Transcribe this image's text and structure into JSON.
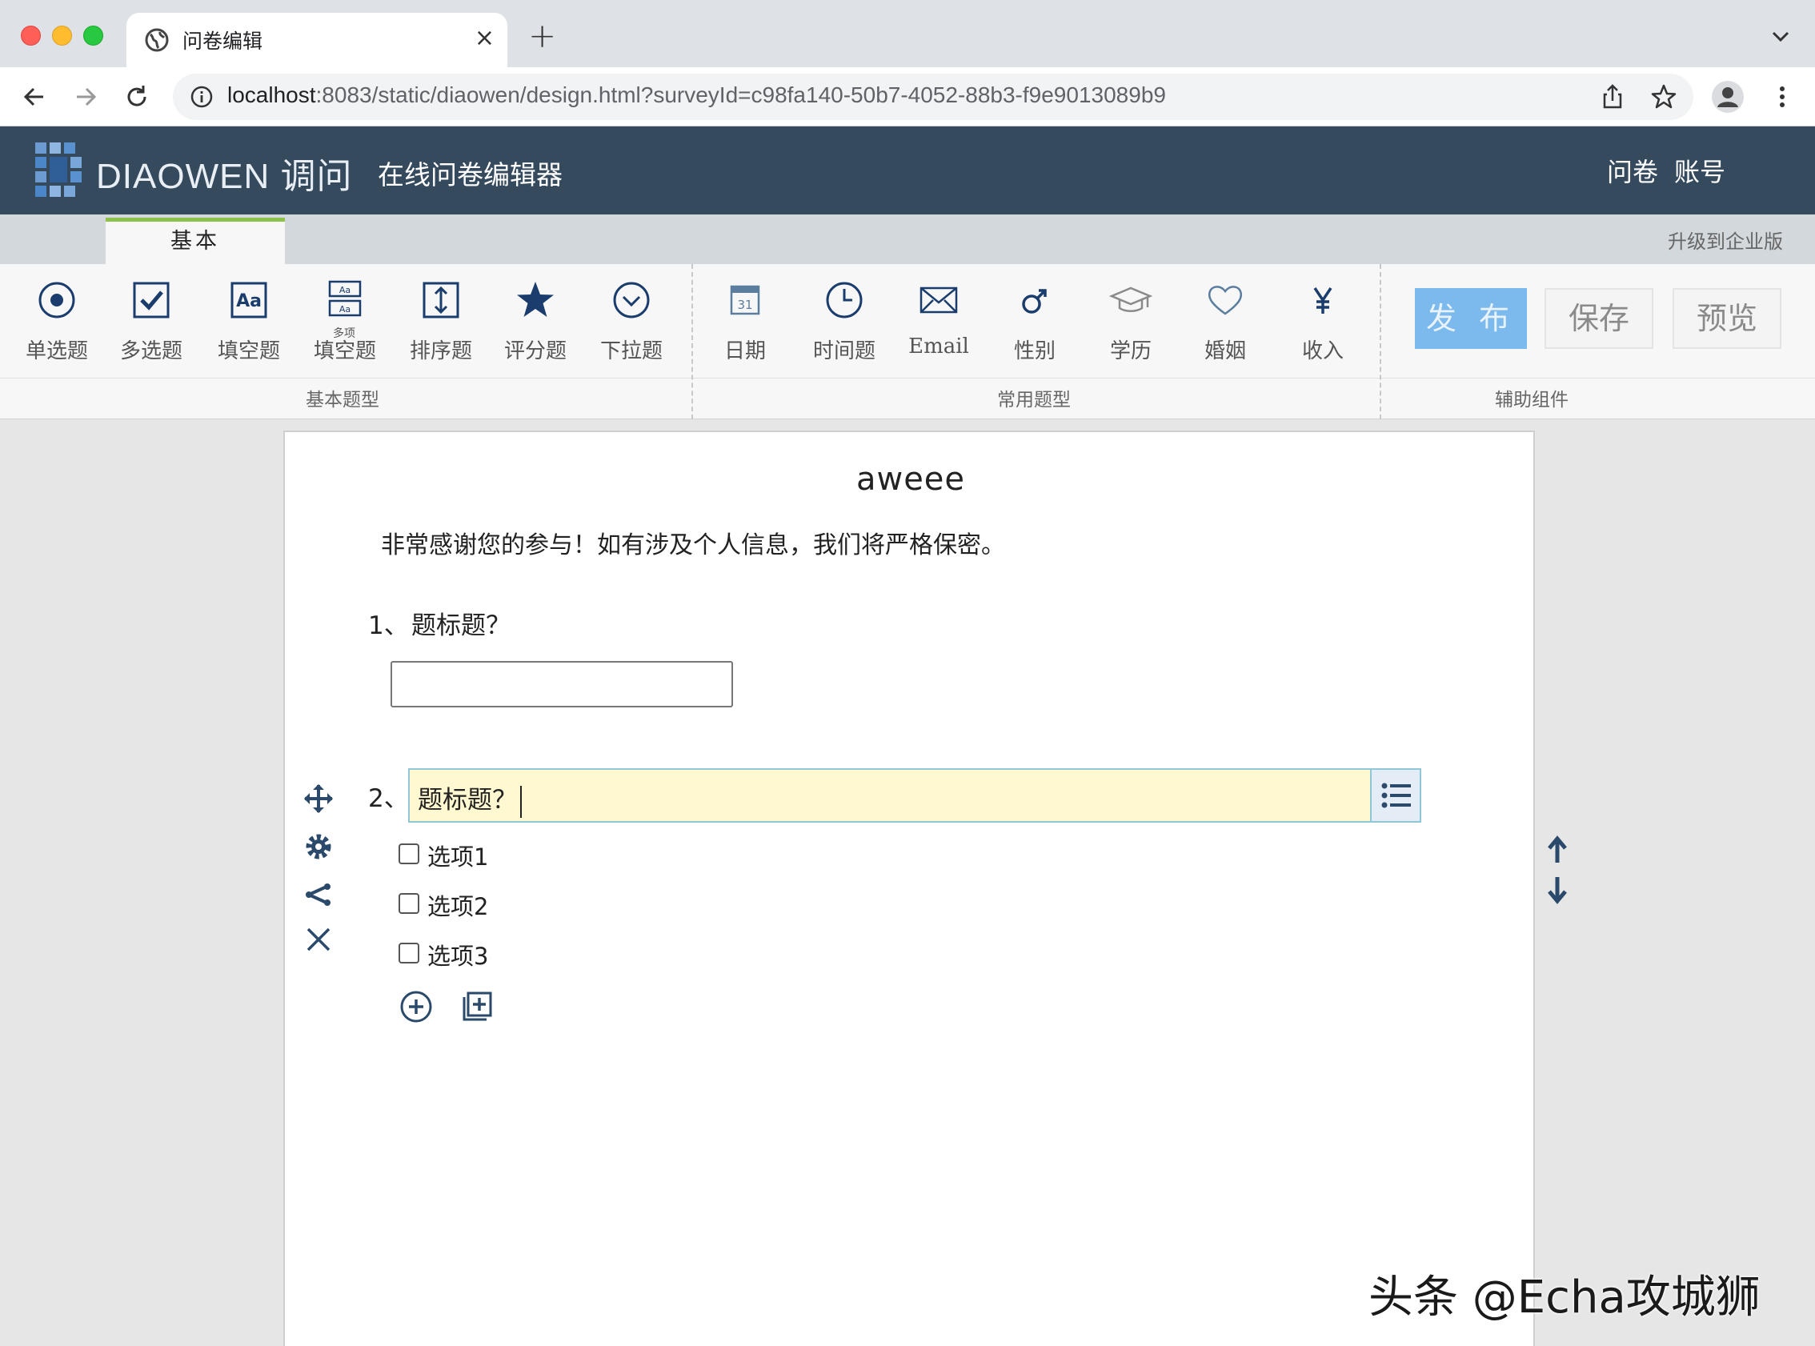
{
  "browser": {
    "tab_title": "问卷编辑",
    "tab_close": "×",
    "new_tab": "+",
    "url_host": "localhost",
    "url_path": ":8083/static/diaowen/design.html?surveyId=c98fa140-50b7-4052-88b3-f9e9013089b9"
  },
  "header": {
    "logo_text": "DIAOWEN 调问",
    "subtitle": "在线问卷编辑器",
    "links": [
      "问卷",
      "账号"
    ]
  },
  "ribbon": {
    "active_tab": "基本",
    "upgrade_link": "升级到企业版",
    "groups": {
      "basic": "基本题型",
      "common": "常用题型",
      "auxiliary": "辅助组件"
    },
    "basic_tools": [
      "单选题",
      "多选题",
      "填空题",
      "填空题",
      "排序题",
      "评分题",
      "下拉题"
    ],
    "multi_fill_badge": "多项",
    "common_tools": [
      "日期",
      "时间题",
      "Email",
      "性别",
      "学历",
      "婚姻",
      "收入"
    ],
    "actions": {
      "publish": "发 布",
      "save": "保存",
      "preview": "预览"
    }
  },
  "survey": {
    "title": "aweee",
    "description": "非常感谢您的参与！如有涉及个人信息，我们将严格保密。",
    "q1": {
      "number": "1、",
      "title": "题标题？"
    },
    "q2": {
      "number": "2、",
      "title": "题标题？",
      "options": [
        "选项1",
        "选项2",
        "选项3"
      ]
    }
  },
  "watermark": "头条 @Echa攻城狮",
  "colors": {
    "header_bg": "#364a5e",
    "ribbon_accent": "#8bc34a",
    "publish_btn": "#7cb9ec",
    "editing_bg": "#fff8d0"
  }
}
